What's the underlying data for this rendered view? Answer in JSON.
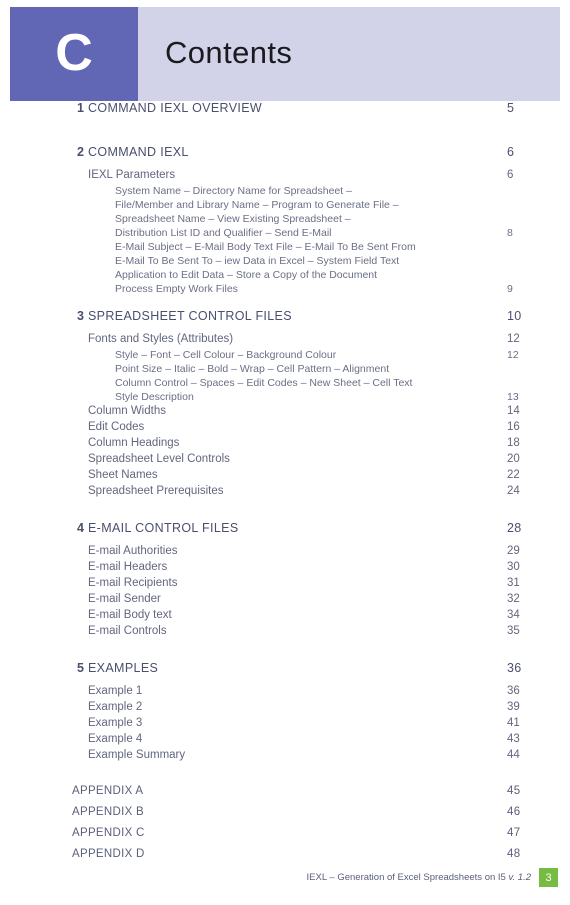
{
  "header": {
    "chapter_letter": "C",
    "title": "Contents",
    "badge_color": "#6167b4",
    "band_color": "#d2d3e8"
  },
  "toc": {
    "entries": [
      {
        "level": "section",
        "num": "1",
        "label": "COMMAND IEXL OVERVIEW",
        "page": "5"
      },
      {
        "level": "gap-lg"
      },
      {
        "level": "section",
        "num": "2",
        "label": "COMMAND IEXL",
        "page": "6"
      },
      {
        "level": "sub",
        "num": "",
        "label": "IEXL Parameters",
        "page": "6"
      },
      {
        "level": "detail",
        "num": "",
        "label": "System Name – Directory Name for Spreadsheet –",
        "page": ""
      },
      {
        "level": "detail",
        "num": "",
        "label": "File/Member and Library Name – Program to Generate File –",
        "page": ""
      },
      {
        "level": "detail",
        "num": "",
        "label": "Spreadsheet Name – View Existing Spreadsheet –",
        "page": ""
      },
      {
        "level": "detail",
        "num": "",
        "label": "Distribution List ID and Qualifier – Send E-Mail",
        "page": "8"
      },
      {
        "level": "detail",
        "num": "",
        "label": "E-Mail Subject – E-Mail Body Text File – E-Mail To Be Sent From",
        "page": ""
      },
      {
        "level": "detail",
        "num": "",
        "label": "E-Mail To Be Sent To – iew Data in Excel – System Field Text",
        "page": ""
      },
      {
        "level": "detail",
        "num": "",
        "label": "Application to Edit Data – Store a Copy of the Document",
        "page": ""
      },
      {
        "level": "detail",
        "num": "",
        "label": "Process Empty Work Files",
        "page": "9"
      },
      {
        "level": "gap-md"
      },
      {
        "level": "section",
        "num": "3",
        "label": "SPREADSHEET CONTROL FILES",
        "page": "10"
      },
      {
        "level": "sub",
        "num": "",
        "label": "Fonts and Styles (Attributes)",
        "page": "12"
      },
      {
        "level": "detail",
        "num": "",
        "label": "Style – Font – Cell Colour – Background Colour",
        "page": "12"
      },
      {
        "level": "detail",
        "num": "",
        "label": "Point Size – Italic – Bold – Wrap – Cell Pattern – Alignment",
        "page": ""
      },
      {
        "level": "detail",
        "num": "",
        "label": "Column Control – Spaces – Edit Codes – New Sheet – Cell Text",
        "page": ""
      },
      {
        "level": "detail",
        "num": "",
        "label": "Style Description",
        "page": "13"
      },
      {
        "level": "sub",
        "num": "",
        "label": "Column Widths",
        "page": "14"
      },
      {
        "level": "sub",
        "num": "",
        "label": "Edit Codes",
        "page": "16"
      },
      {
        "level": "sub",
        "num": "",
        "label": "Column Headings",
        "page": "18"
      },
      {
        "level": "sub",
        "num": "",
        "label": "Spreadsheet Level Controls",
        "page": "20"
      },
      {
        "level": "sub",
        "num": "",
        "label": "Sheet Names",
        "page": "22"
      },
      {
        "level": "sub",
        "num": "",
        "label": "Spreadsheet Prerequisites",
        "page": "24"
      },
      {
        "level": "gap-lg"
      },
      {
        "level": "section",
        "num": "4",
        "label": "E-MAIL CONTROL FILES",
        "page": "28"
      },
      {
        "level": "sub",
        "num": "",
        "label": "E-mail Authorities",
        "page": "29"
      },
      {
        "level": "sub",
        "num": "",
        "label": "E-mail Headers",
        "page": "30"
      },
      {
        "level": "sub",
        "num": "",
        "label": "E-mail Recipients",
        "page": "31"
      },
      {
        "level": "sub",
        "num": "",
        "label": "E-mail Sender",
        "page": "32"
      },
      {
        "level": "sub",
        "num": "",
        "label": "E-mail Body text",
        "page": "34"
      },
      {
        "level": "sub",
        "num": "",
        "label": "E-mail Controls",
        "page": "35"
      },
      {
        "level": "gap-lg"
      },
      {
        "level": "section",
        "num": "5",
        "label": "EXAMPLES",
        "page": "36"
      },
      {
        "level": "sub",
        "num": "",
        "label": "Example 1",
        "page": "36"
      },
      {
        "level": "sub",
        "num": "",
        "label": "Example 2",
        "page": "39"
      },
      {
        "level": "sub",
        "num": "",
        "label": "Example 3",
        "page": "41"
      },
      {
        "level": "sub",
        "num": "",
        "label": "Example 4",
        "page": "43"
      },
      {
        "level": "sub",
        "num": "",
        "label": "Example Summary",
        "page": "44"
      },
      {
        "level": "gap-lg"
      },
      {
        "level": "appendix",
        "num": "",
        "label": "APPENDIX A",
        "page": "45"
      },
      {
        "level": "appendix",
        "num": "",
        "label": "APPENDIX B",
        "page": "46"
      },
      {
        "level": "appendix",
        "num": "",
        "label": "APPENDIX C",
        "page": "47"
      },
      {
        "level": "appendix",
        "num": "",
        "label": "APPENDIX D",
        "page": "48"
      }
    ]
  },
  "footer": {
    "text_main": "IEXL – Generation of Excel Spreadsheets on I5 ",
    "text_version": "v. 1.2",
    "page_number": "3",
    "badge_color": "#76bc43"
  }
}
